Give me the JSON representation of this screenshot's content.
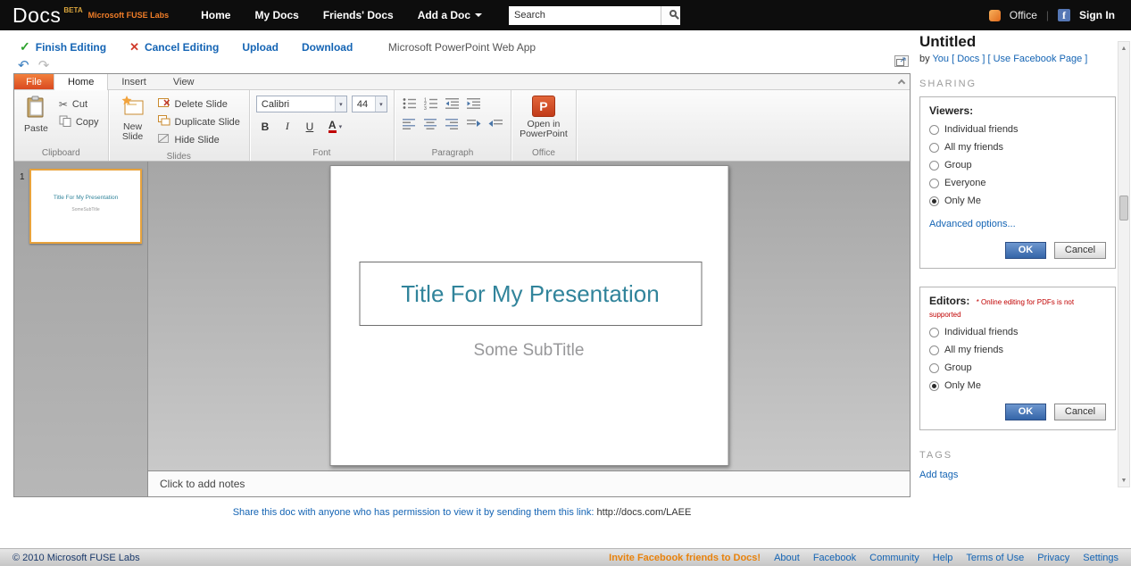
{
  "colors": {
    "accent_blue": "#1464b4",
    "title_teal": "#31849b",
    "invite_orange": "#e8820c",
    "ok_button_blue": "#3465a8",
    "file_tab_orange": "#e05a28",
    "selection_yellow": "#e8a33d"
  },
  "topbar": {
    "logo": "Docs",
    "beta": "BETA",
    "fuse_labs": "Microsoft FUSE Labs",
    "nav": [
      "Home",
      "My Docs",
      "Friends' Docs",
      "Add a Doc"
    ],
    "search_placeholder": "Search",
    "office_label": "Office",
    "facebook_f": "f",
    "sign_in": "Sign In"
  },
  "actionbar": {
    "finish": "Finish Editing",
    "cancel": "Cancel Editing",
    "upload": "Upload",
    "download": "Download",
    "app_title": "Microsoft PowerPoint Web App"
  },
  "ribbon": {
    "file_tab": "File",
    "tabs": [
      "Home",
      "Insert",
      "View"
    ],
    "groups": {
      "clipboard": {
        "label": "Clipboard",
        "paste": "Paste",
        "cut": "Cut",
        "copy": "Copy"
      },
      "slides": {
        "label": "Slides",
        "new_slide": "New Slide",
        "delete_slide": "Delete Slide",
        "duplicate_slide": "Duplicate Slide",
        "hide_slide": "Hide Slide"
      },
      "font": {
        "label": "Font",
        "family": "Calibri",
        "size": "44",
        "bold": "B",
        "italic": "I",
        "underline": "U",
        "color": "A"
      },
      "paragraph": {
        "label": "Paragraph"
      },
      "office": {
        "label": "Office",
        "open": "Open in PowerPoint",
        "ppt_letter": "P"
      }
    }
  },
  "slides_panel": {
    "slide_number": "1",
    "thumb_title": "Title For My Presentation",
    "thumb_subtitle": "SomeSubTitle"
  },
  "canvas": {
    "title": "Title For My Presentation",
    "subtitle": "Some SubTitle",
    "notes_placeholder": "Click to add notes"
  },
  "share": {
    "text": "Share this doc with anyone who has permission to view it by sending them this link:",
    "link": "http://docs.com/LAEE"
  },
  "sidebar": {
    "doc_title": "Untitled",
    "byline": {
      "by": "by",
      "you": "You",
      "docs": "[ Docs ]",
      "use_facebook": "[ Use Facebook Page ]"
    },
    "sharing_header": "SHARING",
    "viewers": {
      "title": "Viewers:",
      "options": [
        "Individual friends",
        "All my friends",
        "Group",
        "Everyone",
        "Only Me"
      ],
      "selected": "Only Me",
      "advanced": "Advanced options...",
      "ok": "OK",
      "cancel": "Cancel"
    },
    "editors": {
      "title": "Editors:",
      "note": "* Online editing for PDFs is not supported",
      "options": [
        "Individual friends",
        "All my friends",
        "Group",
        "Only Me"
      ],
      "selected": "Only Me",
      "ok": "OK",
      "cancel": "Cancel"
    },
    "tags_header": "TAGS",
    "add_tags": "Add tags"
  },
  "footer": {
    "copyright": "© 2010 Microsoft FUSE Labs",
    "invite": "Invite Facebook friends to Docs!",
    "links": [
      "About",
      "Facebook",
      "Community",
      "Help",
      "Terms of Use",
      "Privacy",
      "Settings"
    ]
  }
}
